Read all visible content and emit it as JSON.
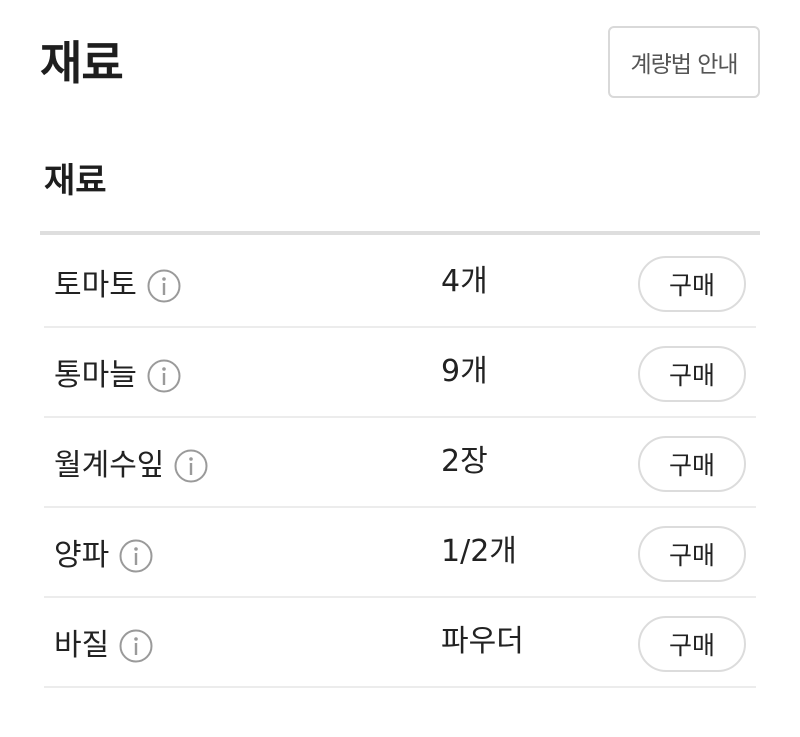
{
  "header": {
    "title": "재료",
    "guide_button_label": "계량법 안내"
  },
  "section": {
    "title": "재료"
  },
  "ingredients": [
    {
      "name": "토마토",
      "amount": "4개",
      "buy_label": "구매"
    },
    {
      "name": "통마늘",
      "amount": "9개",
      "buy_label": "구매"
    },
    {
      "name": "월계수잎",
      "amount": "2장",
      "buy_label": "구매"
    },
    {
      "name": "양파",
      "amount": "1/2개",
      "buy_label": "구매"
    },
    {
      "name": "바질",
      "amount": "파우더",
      "buy_label": "구매"
    }
  ],
  "icons": {
    "info": "info-icon"
  },
  "colors": {
    "text": "#222222",
    "border": "#dcdcdc",
    "icon": "#9a9a9a"
  }
}
